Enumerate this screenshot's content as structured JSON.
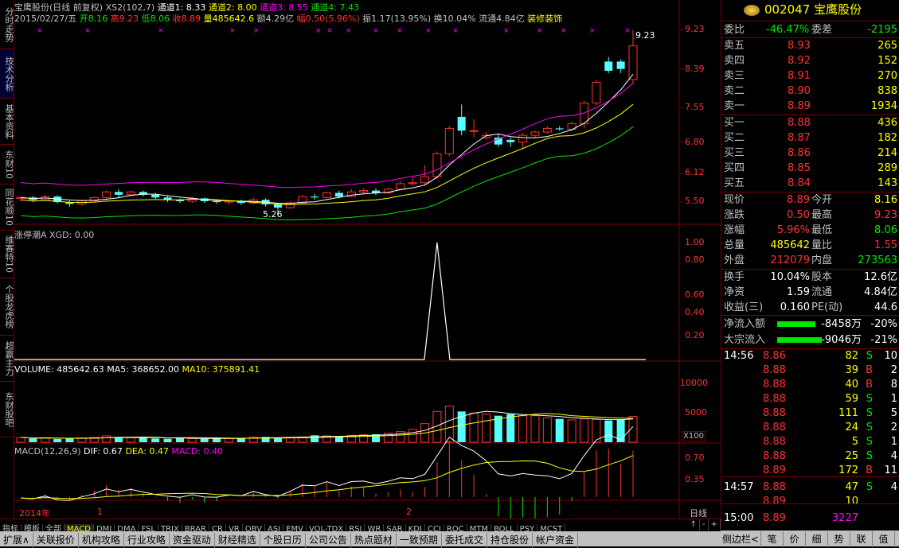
{
  "left_nav": [
    "分时走势",
    "技术分析",
    "基本资料",
    "东财10",
    "同花顺10",
    "维赛特10",
    "个股龙虎榜",
    "超赢主力",
    "东财股吧"
  ],
  "header": {
    "title": "宝鹰股份(日线 前复权)",
    "xs2": "XS2(102,7)",
    "ch1": "通道1: 8.33",
    "ch2": "通道2: 8.00",
    "ch3": "通道3: 8.55",
    "ch4": "通道4: 7.43",
    "date": "2015/02/27/五",
    "open": "开8.16",
    "high": "高9.23",
    "low": "低8.06",
    "close": "收8.89",
    "vol": "量485642.6",
    "amount": "额4.29亿",
    "change": "幅0.50(5.96%)",
    "amplitude": "振1.17(13.95%)",
    "turnover": "换10.04%",
    "float": "流通4.84亿",
    "sector": "装修装饰"
  },
  "panel2": {
    "label": "涨停潮A XGD: 0.00"
  },
  "panel3": {
    "vol": "VOLUME: 485642.63",
    "ma5": "MA5: 368652.00",
    "ma10": "MA10: 375891.41",
    "unit": "X100"
  },
  "panel4": {
    "name": "MACD(12,26,9)",
    "dif": "DIF: 0.67",
    "dea": "DEA: 0.47",
    "macd": "MACD: 0.40"
  },
  "price_axis": [
    "9.23",
    "8.39",
    "7.55",
    "6.80",
    "6.12",
    "5.50"
  ],
  "xgd_axis": [
    "1.00",
    "0.80",
    "0.60",
    "0.40",
    "0.20"
  ],
  "vol_axis": [
    "10000",
    "5000"
  ],
  "macd_axis": [
    "0.70",
    "0.35"
  ],
  "marks": {
    "high": "9.23",
    "low": "5.26",
    "year": "2014年",
    "m1": "1",
    "m2": "2",
    "period": "日线"
  },
  "bottom_tabs": [
    "指标",
    "模板",
    "全部",
    "MACD",
    "DMI",
    "DMA",
    "FSL",
    "TRIX",
    "BRAR",
    "CR",
    "VR",
    "OBV",
    "ASI",
    "EMV",
    "VOL-TDX",
    "RSI",
    "WR",
    "SAR",
    "KDJ",
    "CCI",
    "ROC",
    "MTM",
    "BOLL",
    "PSY",
    "MCST"
  ],
  "toolbar": [
    "扩展∧",
    "关联报价",
    "机构攻略",
    "行业攻略",
    "资金驱动",
    "财经精选",
    "个股日历",
    "公司公告",
    "热点题材",
    "一致预期",
    "委托成交",
    "持仓股份",
    "帐户资金"
  ],
  "right_tabs": [
    "侧边栏<",
    "笔",
    "价",
    "细",
    "势",
    "联",
    "值"
  ],
  "quote": {
    "code": "002047",
    "name": "宝鹰股份",
    "weibi_label": "委比",
    "weibi": "-46.47%",
    "weicha_label": "委差",
    "weicha": "-2195",
    "sell": [
      [
        "卖五",
        "8.93",
        "265"
      ],
      [
        "卖四",
        "8.92",
        "152"
      ],
      [
        "卖三",
        "8.91",
        "270"
      ],
      [
        "卖二",
        "8.90",
        "838"
      ],
      [
        "卖一",
        "8.89",
        "1934"
      ]
    ],
    "buy": [
      [
        "买一",
        "8.88",
        "436"
      ],
      [
        "买二",
        "8.87",
        "182"
      ],
      [
        "买三",
        "8.86",
        "214"
      ],
      [
        "买四",
        "8.85",
        "289"
      ],
      [
        "买五",
        "8.84",
        "143"
      ]
    ],
    "stats1": [
      [
        "现价",
        "8.89",
        "今开",
        "8.16"
      ],
      [
        "涨跌",
        "0.50",
        "最高",
        "9.23"
      ],
      [
        "涨幅",
        "5.96%",
        "最低",
        "8.06"
      ],
      [
        "总量",
        "485642",
        "量比",
        "1.55"
      ],
      [
        "外盘",
        "212079",
        "内盘",
        "273563"
      ]
    ],
    "stats2": [
      [
        "换手",
        "10.04%",
        "股本",
        "12.6亿"
      ],
      [
        "净资",
        "1.59",
        "流通",
        "4.84亿"
      ],
      [
        "收益(三)",
        "0.160",
        "PE(动)",
        "44.6"
      ]
    ],
    "flow": [
      [
        "净流入额",
        "-8458万",
        "-20%"
      ],
      [
        "大宗流入",
        "-9046万",
        "-21%"
      ]
    ],
    "ticks": [
      [
        "14:56",
        "8.86",
        "82",
        "S",
        "10"
      ],
      [
        "",
        "8.88",
        "39",
        "B",
        "2"
      ],
      [
        "",
        "8.88",
        "40",
        "B",
        "8"
      ],
      [
        "",
        "8.88",
        "59",
        "S",
        "1"
      ],
      [
        "",
        "8.88",
        "111",
        "S",
        "5"
      ],
      [
        "",
        "8.88",
        "24",
        "S",
        "2"
      ],
      [
        "",
        "8.88",
        "5",
        "S",
        "1"
      ],
      [
        "",
        "8.88",
        "25",
        "S",
        "4"
      ],
      [
        "",
        "8.89",
        "172",
        "B",
        "11"
      ],
      [
        "14:57",
        "8.88",
        "47",
        "S",
        "4"
      ],
      [
        "",
        "8.89",
        "10",
        "",
        ""
      ],
      [
        "15:00",
        "8.89",
        "3227",
        "",
        ""
      ]
    ]
  },
  "chart_data": {
    "type": "candlestick",
    "ylim": [
      5.26,
      9.23
    ],
    "dates_note_visible": [
      "2014年",
      "1",
      "2"
    ],
    "candles": [
      [
        5.58,
        5.6,
        5.52,
        5.62
      ],
      [
        5.6,
        5.55,
        5.5,
        5.63
      ],
      [
        5.55,
        5.62,
        5.53,
        5.66
      ],
      [
        5.62,
        5.5,
        5.47,
        5.65
      ],
      [
        5.5,
        5.46,
        5.4,
        5.53
      ],
      [
        5.46,
        5.53,
        5.42,
        5.56
      ],
      [
        5.53,
        5.6,
        5.5,
        5.62
      ],
      [
        5.6,
        5.72,
        5.55,
        5.75
      ],
      [
        5.72,
        5.66,
        5.6,
        5.78
      ],
      [
        5.66,
        5.72,
        5.62,
        5.75
      ],
      [
        5.72,
        5.66,
        5.62,
        5.75
      ],
      [
        5.66,
        5.6,
        5.57,
        5.7
      ],
      [
        5.6,
        5.55,
        5.5,
        5.63
      ],
      [
        5.55,
        5.52,
        5.48,
        5.58
      ],
      [
        5.52,
        5.58,
        5.48,
        5.62
      ],
      [
        5.58,
        5.52,
        5.48,
        5.6
      ],
      [
        5.52,
        5.5,
        5.46,
        5.55
      ],
      [
        5.5,
        5.52,
        5.45,
        5.55
      ],
      [
        5.52,
        5.48,
        5.44,
        5.55
      ],
      [
        5.48,
        5.55,
        5.45,
        5.6
      ],
      [
        5.55,
        5.45,
        5.4,
        5.58
      ],
      [
        5.45,
        5.38,
        5.26,
        5.48
      ],
      [
        5.38,
        5.48,
        5.35,
        5.52
      ],
      [
        5.48,
        5.62,
        5.45,
        5.65
      ],
      [
        5.62,
        5.6,
        5.55,
        5.68
      ],
      [
        5.6,
        5.7,
        5.58,
        5.73
      ],
      [
        5.7,
        5.62,
        5.58,
        5.75
      ],
      [
        5.62,
        5.72,
        5.6,
        5.78
      ],
      [
        5.72,
        5.75,
        5.68,
        5.8
      ],
      [
        5.75,
        5.7,
        5.65,
        5.8
      ],
      [
        5.7,
        5.78,
        5.68,
        5.82
      ],
      [
        5.78,
        5.9,
        5.75,
        5.95
      ],
      [
        5.9,
        5.92,
        5.85,
        6.05
      ],
      [
        5.92,
        6.05,
        5.88,
        6.3
      ],
      [
        6.05,
        6.55,
        6.0,
        6.6
      ],
      [
        6.55,
        7.1,
        6.5,
        7.15
      ],
      [
        7.35,
        7.05,
        6.95,
        7.62
      ],
      [
        7.05,
        7.05,
        6.9,
        7.3
      ],
      [
        6.9,
        6.95,
        6.85,
        7.02
      ],
      [
        6.9,
        6.75,
        6.7,
        6.98
      ],
      [
        6.85,
        6.8,
        6.7,
        6.9
      ],
      [
        6.8,
        6.95,
        6.65,
        7.0
      ],
      [
        6.95,
        7.02,
        6.9,
        7.05
      ],
      [
        7.02,
        7.1,
        6.98,
        7.15
      ],
      [
        7.1,
        7.08,
        7.05,
        7.15
      ],
      [
        7.08,
        7.2,
        7.05,
        7.25
      ],
      [
        7.2,
        7.65,
        7.1,
        7.7
      ],
      [
        7.65,
        8.1,
        7.6,
        8.15
      ],
      [
        8.55,
        8.35,
        8.3,
        8.65
      ],
      [
        8.55,
        8.39,
        8.3,
        8.6
      ],
      [
        8.16,
        8.89,
        8.06,
        9.23
      ]
    ],
    "volume": [
      900,
      700,
      850,
      600,
      700,
      800,
      900,
      1200,
      1000,
      850,
      900,
      700,
      650,
      800,
      700,
      650,
      750,
      700,
      800,
      950,
      1000,
      900,
      900,
      1000,
      1300,
      1200,
      1150,
      1300,
      1400,
      1500,
      1700,
      2000,
      2400,
      3500,
      5800,
      6800,
      5800,
      5500,
      5300,
      5000,
      5300,
      5000,
      5000,
      4600,
      4400,
      4200,
      4400,
      4300,
      4100,
      4300,
      4856
    ],
    "xgd": {
      "peak_index": 34,
      "peak_value": 1.0
    }
  }
}
